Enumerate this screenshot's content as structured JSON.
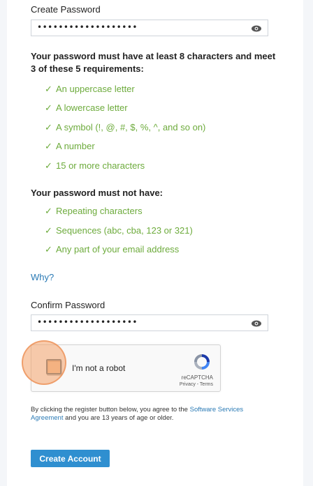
{
  "create_password": {
    "label": "Create Password",
    "value": "•••••••••••••••••••"
  },
  "requirements": {
    "title": "Your password must have at least 8 characters and meet 3 of these 5 requirements:",
    "items": [
      "An uppercase letter",
      "A lowercase letter",
      "A symbol (!, @, #, $, %, ^, and so on)",
      "A number",
      "15 or more characters"
    ]
  },
  "restrictions": {
    "title": "Your password must not have:",
    "items": [
      "Repeating characters",
      "Sequences (abc, cba, 123 or 321)",
      "Any part of your email address"
    ]
  },
  "why_link": "Why?",
  "confirm_password": {
    "label": "Confirm Password",
    "value": "•••••••••••••••••••"
  },
  "captcha": {
    "label": "I'm not a robot",
    "brand": "reCAPTCHA",
    "links": "Privacy - Terms"
  },
  "terms": {
    "prefix": "By clicking the register button below, you agree to the ",
    "link": "Software Services Agreement",
    "suffix": " and you are 13 years of age or older."
  },
  "submit_label": "Create Account",
  "colors": {
    "accent": "#2f8fd0",
    "success": "#6dab3c",
    "link": "#2a7ab5"
  }
}
